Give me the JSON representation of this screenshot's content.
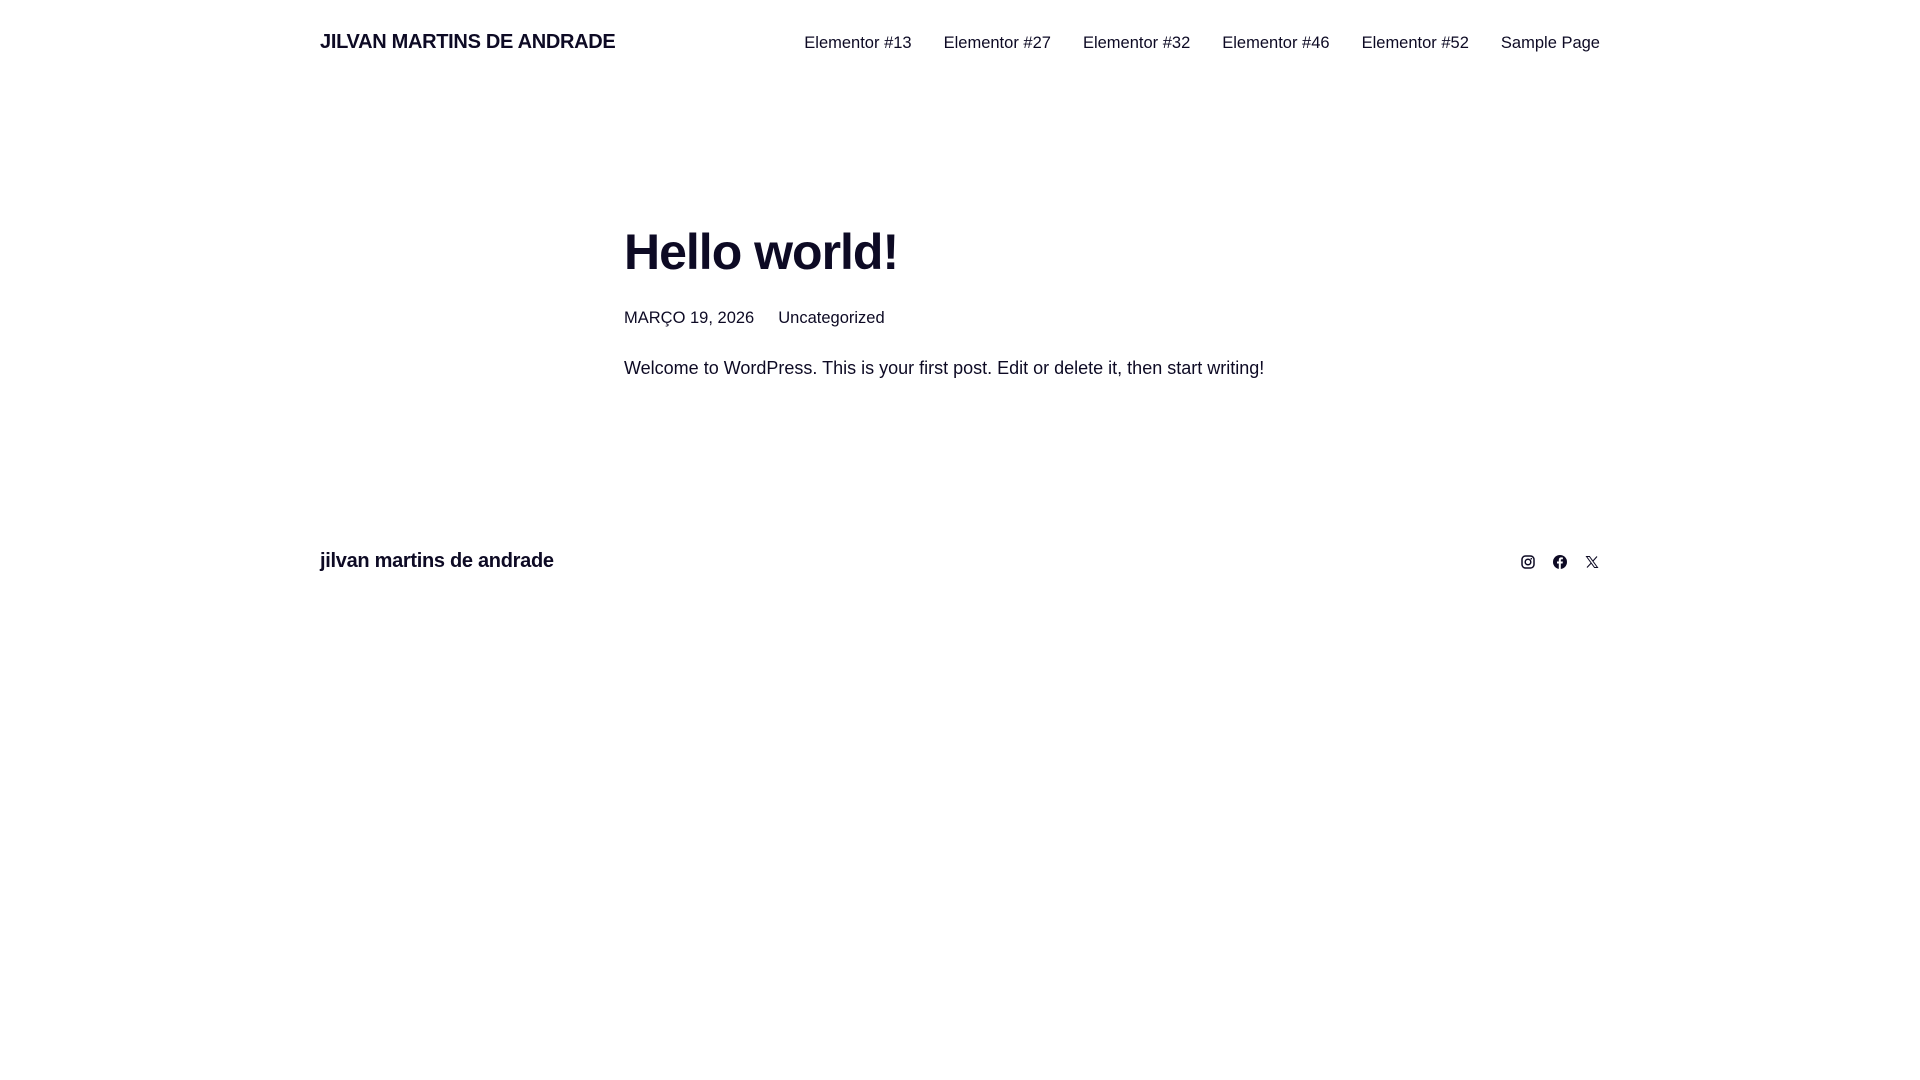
{
  "header": {
    "site_title": "JILVAN MARTINS DE ANDRADE",
    "nav": [
      "Elementor #13",
      "Elementor #27",
      "Elementor #32",
      "Elementor #46",
      "Elementor #52",
      "Sample Page"
    ]
  },
  "post": {
    "title": "Hello world!",
    "date": "MARÇO 19, 2026",
    "category": "Uncategorized",
    "content": "Welcome to WordPress. This is your first post. Edit or delete it, then start writing!"
  },
  "footer": {
    "site_title": "jilvan martins de andrade",
    "social": [
      "instagram-icon",
      "facebook-icon",
      "x-icon"
    ]
  }
}
